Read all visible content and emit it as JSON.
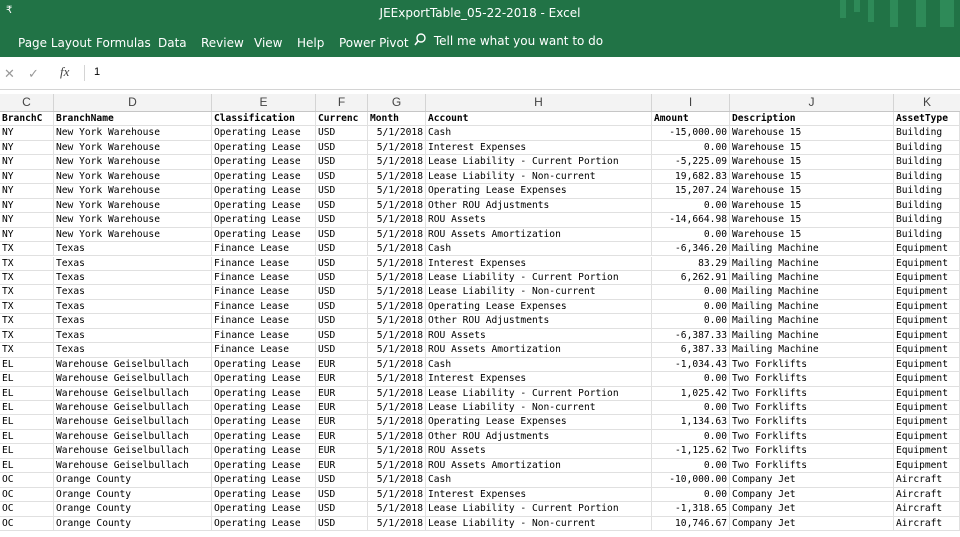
{
  "window": {
    "title": "JEExportTable_05-22-2018  -  Excel",
    "quick_access": "₹"
  },
  "ribbon": {
    "tabs": [
      "Page Layout",
      "Formulas",
      "Data",
      "Review",
      "View",
      "Help",
      "Power Pivot"
    ],
    "tell_me": "Tell me what you want to do"
  },
  "formula_bar": {
    "cancel": "✕",
    "enter": "✓",
    "fx": "fx",
    "value": "1"
  },
  "columns": [
    "C",
    "D",
    "E",
    "F",
    "G",
    "H",
    "I",
    "J",
    "K"
  ],
  "header_row": [
    "BranchC",
    "BranchName",
    "Classification",
    "Currenc",
    "Month",
    "Account",
    "Amount",
    "Description",
    "AssetType"
  ],
  "rows": [
    [
      "NY",
      "New York Warehouse",
      "Operating Lease",
      "USD",
      "5/1/2018",
      "Cash",
      "-15,000.00",
      "Warehouse 15",
      "Building"
    ],
    [
      "NY",
      "New York Warehouse",
      "Operating Lease",
      "USD",
      "5/1/2018",
      "Interest Expenses",
      "0.00",
      "Warehouse 15",
      "Building"
    ],
    [
      "NY",
      "New York Warehouse",
      "Operating Lease",
      "USD",
      "5/1/2018",
      "Lease Liability - Current Portion",
      "-5,225.09",
      "Warehouse 15",
      "Building"
    ],
    [
      "NY",
      "New York Warehouse",
      "Operating Lease",
      "USD",
      "5/1/2018",
      "Lease Liability - Non-current",
      "19,682.83",
      "Warehouse 15",
      "Building"
    ],
    [
      "NY",
      "New York Warehouse",
      "Operating Lease",
      "USD",
      "5/1/2018",
      "Operating Lease Expenses",
      "15,207.24",
      "Warehouse 15",
      "Building"
    ],
    [
      "NY",
      "New York Warehouse",
      "Operating Lease",
      "USD",
      "5/1/2018",
      "Other ROU Adjustments",
      "0.00",
      "Warehouse 15",
      "Building"
    ],
    [
      "NY",
      "New York Warehouse",
      "Operating Lease",
      "USD",
      "5/1/2018",
      "ROU Assets",
      "-14,664.98",
      "Warehouse 15",
      "Building"
    ],
    [
      "NY",
      "New York Warehouse",
      "Operating Lease",
      "USD",
      "5/1/2018",
      "ROU Assets Amortization",
      "0.00",
      "Warehouse 15",
      "Building"
    ],
    [
      "TX",
      "Texas",
      "Finance Lease",
      "USD",
      "5/1/2018",
      "Cash",
      "-6,346.20",
      "Mailing Machine",
      "Equipment"
    ],
    [
      "TX",
      "Texas",
      "Finance Lease",
      "USD",
      "5/1/2018",
      "Interest Expenses",
      "83.29",
      "Mailing Machine",
      "Equipment"
    ],
    [
      "TX",
      "Texas",
      "Finance Lease",
      "USD",
      "5/1/2018",
      "Lease Liability - Current Portion",
      "6,262.91",
      "Mailing Machine",
      "Equipment"
    ],
    [
      "TX",
      "Texas",
      "Finance Lease",
      "USD",
      "5/1/2018",
      "Lease Liability - Non-current",
      "0.00",
      "Mailing Machine",
      "Equipment"
    ],
    [
      "TX",
      "Texas",
      "Finance Lease",
      "USD",
      "5/1/2018",
      "Operating Lease Expenses",
      "0.00",
      "Mailing Machine",
      "Equipment"
    ],
    [
      "TX",
      "Texas",
      "Finance Lease",
      "USD",
      "5/1/2018",
      "Other ROU Adjustments",
      "0.00",
      "Mailing Machine",
      "Equipment"
    ],
    [
      "TX",
      "Texas",
      "Finance Lease",
      "USD",
      "5/1/2018",
      "ROU Assets",
      "-6,387.33",
      "Mailing Machine",
      "Equipment"
    ],
    [
      "TX",
      "Texas",
      "Finance Lease",
      "USD",
      "5/1/2018",
      "ROU Assets Amortization",
      "6,387.33",
      "Mailing Machine",
      "Equipment"
    ],
    [
      "EL",
      "Warehouse Geiselbullach",
      "Operating Lease",
      "EUR",
      "5/1/2018",
      "Cash",
      "-1,034.43",
      "Two Forklifts",
      "Equipment"
    ],
    [
      "EL",
      "Warehouse Geiselbullach",
      "Operating Lease",
      "EUR",
      "5/1/2018",
      "Interest Expenses",
      "0.00",
      "Two Forklifts",
      "Equipment"
    ],
    [
      "EL",
      "Warehouse Geiselbullach",
      "Operating Lease",
      "EUR",
      "5/1/2018",
      "Lease Liability - Current Portion",
      "1,025.42",
      "Two Forklifts",
      "Equipment"
    ],
    [
      "EL",
      "Warehouse Geiselbullach",
      "Operating Lease",
      "EUR",
      "5/1/2018",
      "Lease Liability - Non-current",
      "0.00",
      "Two Forklifts",
      "Equipment"
    ],
    [
      "EL",
      "Warehouse Geiselbullach",
      "Operating Lease",
      "EUR",
      "5/1/2018",
      "Operating Lease Expenses",
      "1,134.63",
      "Two Forklifts",
      "Equipment"
    ],
    [
      "EL",
      "Warehouse Geiselbullach",
      "Operating Lease",
      "EUR",
      "5/1/2018",
      "Other ROU Adjustments",
      "0.00",
      "Two Forklifts",
      "Equipment"
    ],
    [
      "EL",
      "Warehouse Geiselbullach",
      "Operating Lease",
      "EUR",
      "5/1/2018",
      "ROU Assets",
      "-1,125.62",
      "Two Forklifts",
      "Equipment"
    ],
    [
      "EL",
      "Warehouse Geiselbullach",
      "Operating Lease",
      "EUR",
      "5/1/2018",
      "ROU Assets Amortization",
      "0.00",
      "Two Forklifts",
      "Equipment"
    ],
    [
      "OC",
      "Orange County",
      "Operating Lease",
      "USD",
      "5/1/2018",
      "Cash",
      "-10,000.00",
      "Company Jet",
      "Aircraft"
    ],
    [
      "OC",
      "Orange County",
      "Operating Lease",
      "USD",
      "5/1/2018",
      "Interest Expenses",
      "0.00",
      "Company Jet",
      "Aircraft"
    ],
    [
      "OC",
      "Orange County",
      "Operating Lease",
      "USD",
      "5/1/2018",
      "Lease Liability - Current Portion",
      "-1,318.65",
      "Company Jet",
      "Aircraft"
    ],
    [
      "OC",
      "Orange County",
      "Operating Lease",
      "USD",
      "5/1/2018",
      "Lease Liability - Non-current",
      "10,746.67",
      "Company Jet",
      "Aircraft"
    ]
  ]
}
